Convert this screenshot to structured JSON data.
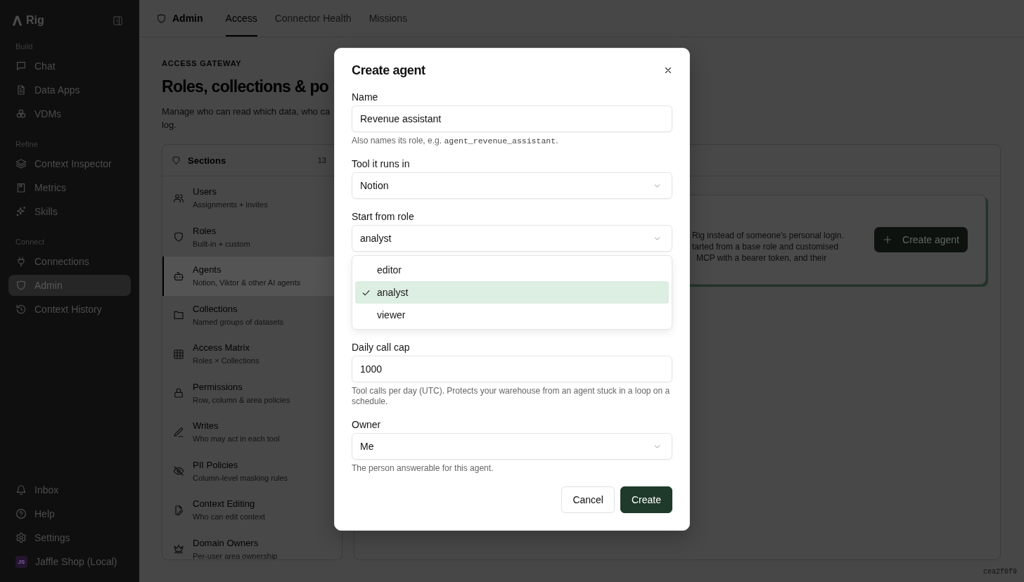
{
  "sidebar": {
    "brand": "Rig",
    "groups": [
      {
        "label": "Build",
        "items": [
          {
            "label": "Chat",
            "selected": false
          },
          {
            "label": "Data Apps",
            "selected": false
          },
          {
            "label": "VDMs",
            "selected": false
          }
        ]
      },
      {
        "label": "Refine",
        "items": [
          {
            "label": "Context Inspector",
            "selected": false
          },
          {
            "label": "Metrics",
            "selected": false
          },
          {
            "label": "Skills",
            "selected": false
          }
        ]
      },
      {
        "label": "Connect",
        "items": [
          {
            "label": "Connections",
            "selected": false
          },
          {
            "label": "Admin",
            "selected": true
          },
          {
            "label": "Context History",
            "selected": false
          }
        ]
      }
    ],
    "footer_items": [
      {
        "label": "Inbox",
        "selected": false
      },
      {
        "label": "Help",
        "selected": false
      },
      {
        "label": "Settings",
        "selected": false
      }
    ],
    "workspace": {
      "initials": "JS",
      "name": "Jaffle Shop (Local)"
    }
  },
  "top_nav": {
    "title": "Admin",
    "tabs": [
      {
        "label": "Access",
        "selected": true
      },
      {
        "label": "Connector Health",
        "selected": false
      },
      {
        "label": "Missions",
        "selected": false
      }
    ]
  },
  "page_header": {
    "eyebrow": "ACCESS GATEWAY",
    "title": "Roles, collections & po",
    "description_lines": [
      "Manage who can read which data, who ca",
      "log."
    ]
  },
  "sections_panel": {
    "title": "Sections",
    "count": "13",
    "items": [
      {
        "title": "Users",
        "subtitle": "Assignments + invites",
        "selected": false
      },
      {
        "title": "Roles",
        "subtitle": "Built-in + custom",
        "selected": false
      },
      {
        "title": "Agents",
        "subtitle": "Notion, Viktor & other AI agents",
        "selected": true
      },
      {
        "title": "Collections",
        "subtitle": "Named groups of datasets",
        "selected": false
      },
      {
        "title": "Access Matrix",
        "subtitle": "Roles × Collections",
        "selected": false
      },
      {
        "title": "Permissions",
        "subtitle": "Row, column & area policies",
        "selected": false
      },
      {
        "title": "Writes",
        "subtitle": "Who may act in each tool",
        "selected": false
      },
      {
        "title": "PII Policies",
        "subtitle": "Column-level masking rules",
        "selected": false
      },
      {
        "title": "Context Editing",
        "subtitle": "Who can edit context",
        "selected": false
      },
      {
        "title": "Domain Owners",
        "subtitle": "Per-user area ownership",
        "selected": false
      }
    ]
  },
  "agents_panel": {
    "intro_lines": [
      "Rig instead of someone's personal login.",
      "tarted from a base role and customised",
      "MCP with a bearer token, and their"
    ],
    "create_button": "Create agent"
  },
  "dialog": {
    "title": "Create agent",
    "fields": [
      {
        "kind": "text",
        "label": "Name",
        "value": "Revenue assistant",
        "hint": [
          {
            "kind": "text",
            "text": "Also names its role, e.g. "
          },
          {
            "kind": "code",
            "text": "agent_revenue_assistant"
          },
          {
            "kind": "text",
            "text": "."
          }
        ]
      },
      {
        "kind": "select",
        "label": "Tool it runs in",
        "value": "Notion"
      },
      {
        "kind": "select",
        "label": "Start from role",
        "value": "analyst",
        "open": true,
        "options": [
          {
            "label": "editor",
            "selected": false
          },
          {
            "label": "analyst",
            "selected": true
          },
          {
            "label": "viewer",
            "selected": false
          }
        ]
      },
      {
        "kind": "text",
        "label": "Daily call cap",
        "value": "1000",
        "hint": [
          {
            "kind": "text",
            "text": "Tool calls per day (UTC). Protects your warehouse from an agent stuck in a loop on a schedule."
          }
        ]
      },
      {
        "kind": "select",
        "label": "Owner",
        "value": "Me",
        "hint": [
          {
            "kind": "text",
            "text": "The person answerable for this agent."
          }
        ]
      }
    ],
    "buttons": [
      {
        "label": "Cancel",
        "kind": "secondary"
      },
      {
        "label": "Create",
        "kind": "primary"
      }
    ]
  },
  "build_id": "cea2f0f9"
}
